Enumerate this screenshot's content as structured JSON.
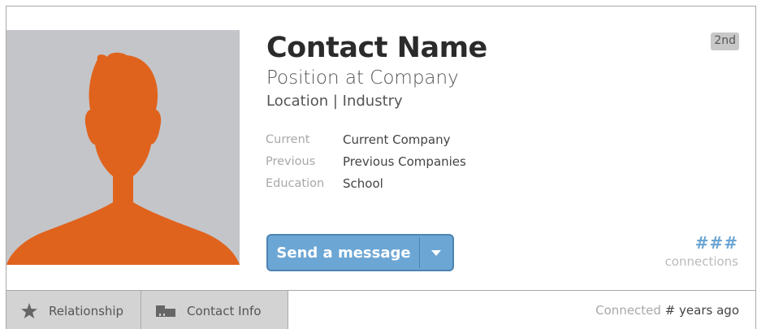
{
  "profile": {
    "name": "Contact Name",
    "position": "Position at Company",
    "location": "Location | Industry",
    "degree": "2nd"
  },
  "details": [
    {
      "label": "Current",
      "value": "Current Company"
    },
    {
      "label": "Previous",
      "value": "Previous Companies"
    },
    {
      "label": "Education",
      "value": "School"
    }
  ],
  "actions": {
    "send_message_label": "Send a message"
  },
  "connections": {
    "count": "###",
    "label": "connections"
  },
  "footer": {
    "tabs": [
      {
        "label": "Relationship",
        "icon": "star-icon"
      },
      {
        "label": "Contact Info",
        "icon": "contact-card-icon"
      }
    ],
    "connected_prefix": "Connected",
    "connected_value": "# years ago"
  },
  "colors": {
    "avatar_bg": "#c4c5c9",
    "avatar_silhouette": "#e0631d",
    "button_blue": "#6ca6d4",
    "tab_bg": "#d3d3d3"
  }
}
